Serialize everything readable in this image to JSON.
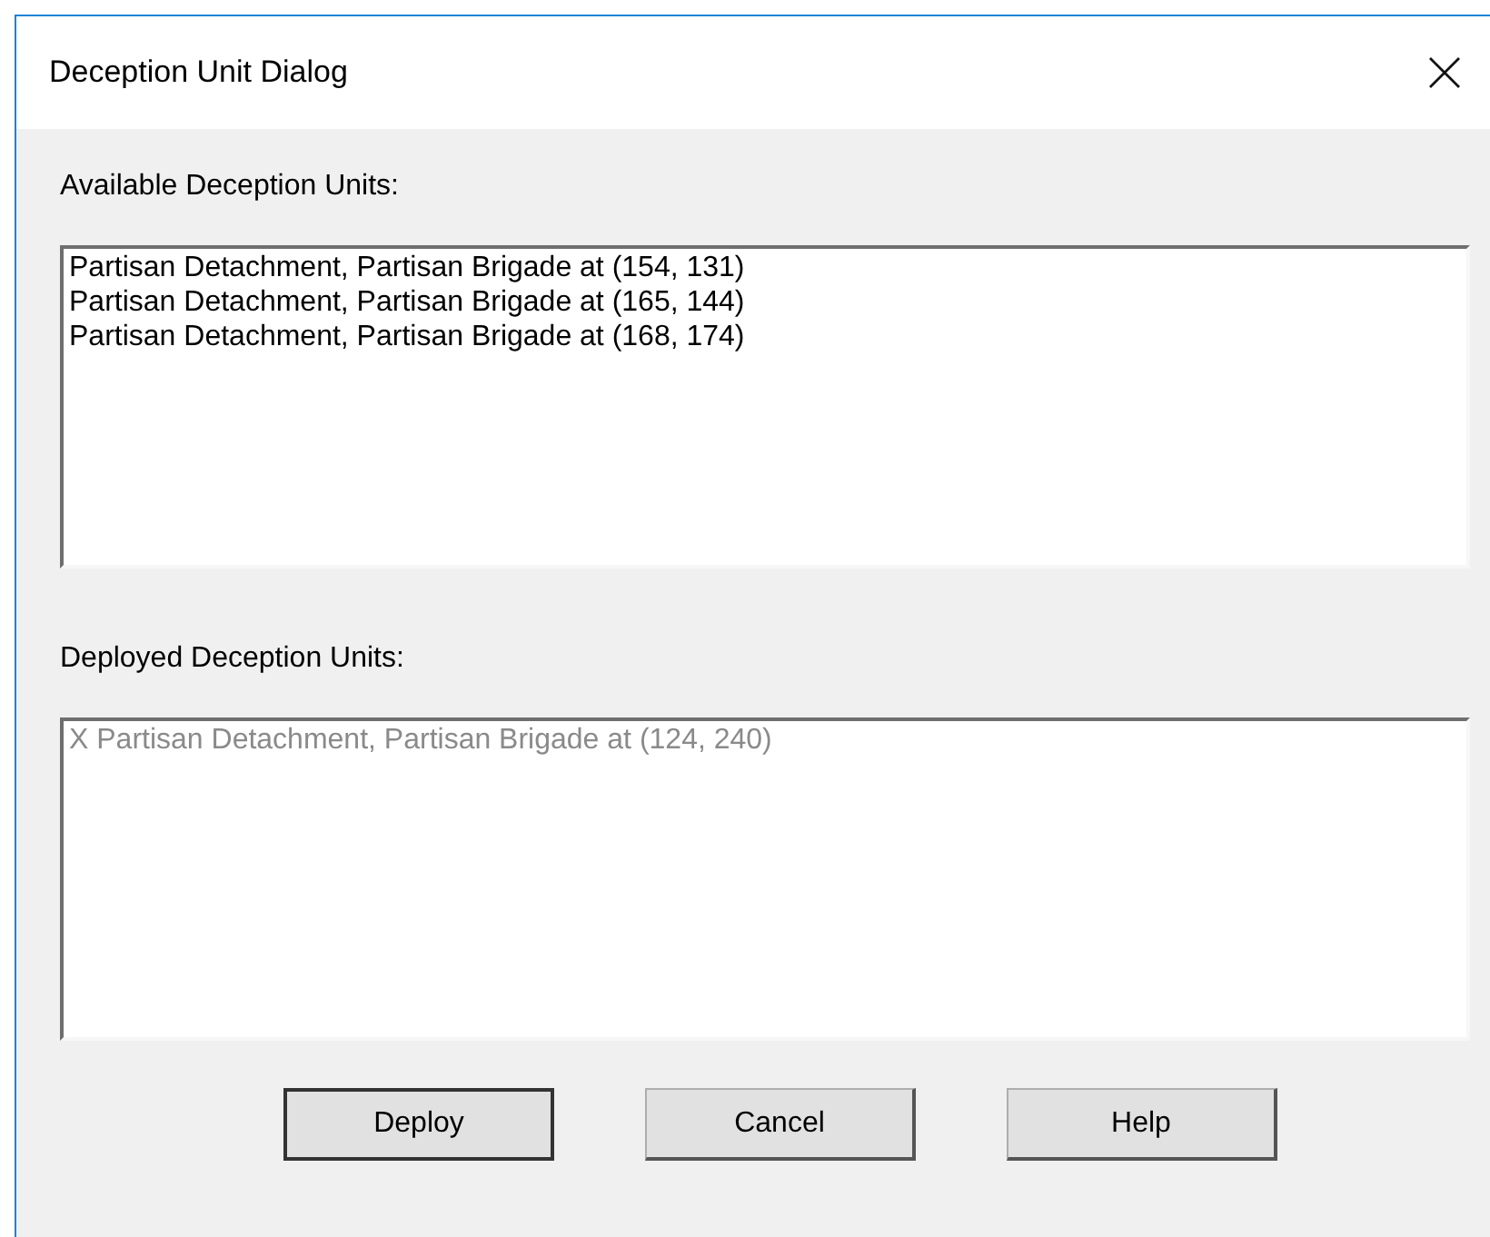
{
  "window": {
    "title": "Deception Unit Dialog"
  },
  "lists": [
    {
      "label": "Available Deception Units:",
      "disabled": false,
      "items": [
        "Partisan Detachment, Partisan Brigade at (154, 131)",
        "Partisan Detachment, Partisan Brigade at (165, 144)",
        "Partisan Detachment, Partisan Brigade at (168, 174)"
      ]
    },
    {
      "label": "Deployed Deception Units:",
      "disabled": true,
      "items": [
        "X Partisan Detachment, Partisan Brigade at (124, 240)"
      ]
    }
  ],
  "buttons": [
    {
      "label": "Deploy",
      "default": true
    },
    {
      "label": "Cancel",
      "default": false
    },
    {
      "label": "Help",
      "default": false
    }
  ]
}
